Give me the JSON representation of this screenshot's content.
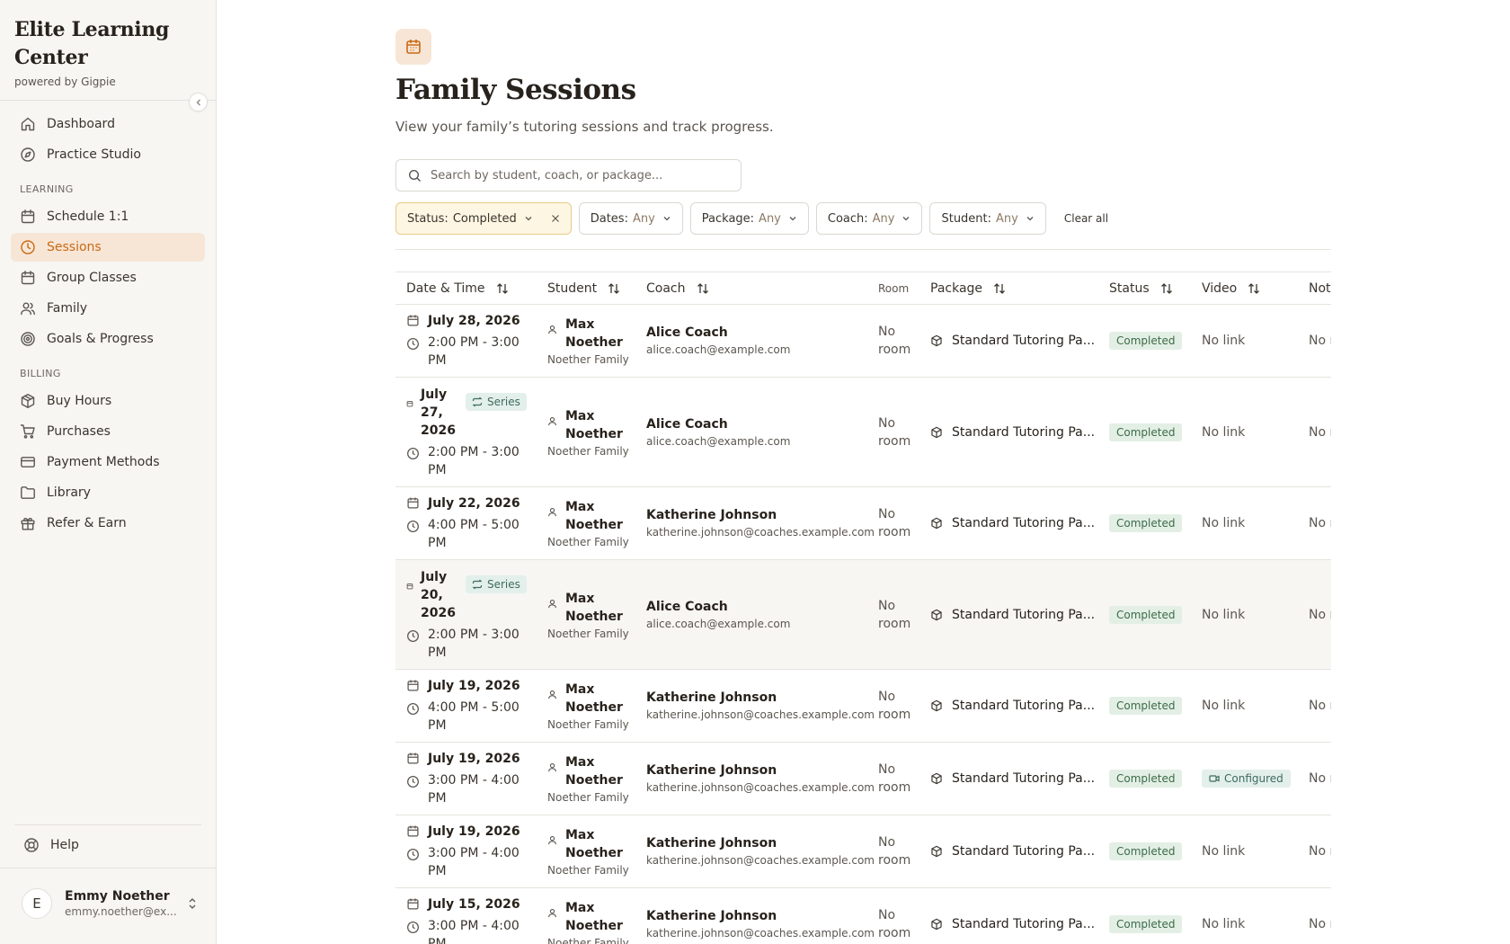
{
  "brand": {
    "title": "Elite Learning Center",
    "subtitle": "powered by Gigpie"
  },
  "nav": {
    "top": [
      {
        "label": "Dashboard",
        "icon": "home-icon"
      },
      {
        "label": "Practice Studio",
        "icon": "compass-icon"
      }
    ],
    "learning_label": "LEARNING",
    "learning": [
      {
        "label": "Schedule 1:1",
        "icon": "calendar-icon"
      },
      {
        "label": "Sessions",
        "icon": "clock-icon",
        "active": true
      },
      {
        "label": "Group Classes",
        "icon": "calendar-icon"
      },
      {
        "label": "Family",
        "icon": "users-icon"
      },
      {
        "label": "Goals & Progress",
        "icon": "target-icon"
      }
    ],
    "billing_label": "BILLING",
    "billing": [
      {
        "label": "Buy Hours",
        "icon": "package-icon"
      },
      {
        "label": "Purchases",
        "icon": "cart-icon"
      },
      {
        "label": "Payment Methods",
        "icon": "card-icon"
      },
      {
        "label": "Library",
        "icon": "folder-icon"
      },
      {
        "label": "Refer & Earn",
        "icon": "gift-icon"
      }
    ],
    "help": "Help"
  },
  "user": {
    "initial": "E",
    "name": "Emmy Noether",
    "email": "emmy.noether@ex..."
  },
  "page": {
    "title": "Family Sessions",
    "subtitle": "View your family’s tutoring sessions and track progress."
  },
  "search": {
    "placeholder": "Search by student, coach, or package..."
  },
  "filters": [
    {
      "key": "Status:",
      "value": "Completed",
      "active": true
    },
    {
      "key": "Dates:",
      "value": "Any"
    },
    {
      "key": "Package:",
      "value": "Any"
    },
    {
      "key": "Coach:",
      "value": "Any"
    },
    {
      "key": "Student:",
      "value": "Any"
    }
  ],
  "clear_all": "Clear all",
  "table": {
    "columns": {
      "datetime": "Date & Time",
      "student": "Student",
      "coach": "Coach",
      "room": "Room",
      "package": "Package",
      "status": "Status",
      "video": "Video",
      "notes": "Notes"
    },
    "series_label": "Series",
    "rows": [
      {
        "date": "July 28, 2026",
        "time": "2:00 PM - 3:00 PM",
        "series": false,
        "student": "Max Noether",
        "family": "Noether Family",
        "coach": "Alice Coach",
        "coach_email": "alice.coach@example.com",
        "room": "No room",
        "package": "Standard Tutoring Pa...",
        "status": "Completed",
        "video": "No link",
        "notes": "No n"
      },
      {
        "date": "July 27, 2026",
        "time": "2:00 PM - 3:00 PM",
        "series": true,
        "student": "Max Noether",
        "family": "Noether Family",
        "coach": "Alice Coach",
        "coach_email": "alice.coach@example.com",
        "room": "No room",
        "package": "Standard Tutoring Pa...",
        "status": "Completed",
        "video": "No link",
        "notes": "No n"
      },
      {
        "date": "July 22, 2026",
        "time": "4:00 PM - 5:00 PM",
        "series": false,
        "student": "Max Noether",
        "family": "Noether Family",
        "coach": "Katherine Johnson",
        "coach_email": "katherine.johnson@coaches.example.com",
        "room": "No room",
        "package": "Standard Tutoring Pa...",
        "status": "Completed",
        "video": "No link",
        "notes": "No n"
      },
      {
        "date": "July 20, 2026",
        "time": "2:00 PM - 3:00 PM",
        "series": true,
        "highlight": true,
        "student": "Max Noether",
        "family": "Noether Family",
        "coach": "Alice Coach",
        "coach_email": "alice.coach@example.com",
        "room": "No room",
        "package": "Standard Tutoring Pa...",
        "status": "Completed",
        "video": "No link",
        "notes": "No n"
      },
      {
        "date": "July 19, 2026",
        "time": "4:00 PM - 5:00 PM",
        "series": false,
        "student": "Max Noether",
        "family": "Noether Family",
        "coach": "Katherine Johnson",
        "coach_email": "katherine.johnson@coaches.example.com",
        "room": "No room",
        "package": "Standard Tutoring Pa...",
        "status": "Completed",
        "video": "No link",
        "notes": "No n"
      },
      {
        "date": "July 19, 2026",
        "time": "3:00 PM - 4:00 PM",
        "series": false,
        "student": "Max Noether",
        "family": "Noether Family",
        "coach": "Katherine Johnson",
        "coach_email": "katherine.johnson@coaches.example.com",
        "room": "No room",
        "package": "Standard Tutoring Pa...",
        "status": "Completed",
        "video": "Configured",
        "video_configured": true,
        "notes": "No n"
      },
      {
        "date": "July 19, 2026",
        "time": "3:00 PM - 4:00 PM",
        "series": false,
        "student": "Max Noether",
        "family": "Noether Family",
        "coach": "Katherine Johnson",
        "coach_email": "katherine.johnson@coaches.example.com",
        "room": "No room",
        "package": "Standard Tutoring Pa...",
        "status": "Completed",
        "video": "No link",
        "notes": "No n"
      },
      {
        "date": "July 15, 2026",
        "time": "3:00 PM - 4:00 PM",
        "series": false,
        "student": "Max Noether",
        "family": "Noether Family",
        "coach": "Katherine Johnson",
        "coach_email": "katherine.johnson@coaches.example.com",
        "room": "No room",
        "package": "Standard Tutoring Pa...",
        "status": "Completed",
        "video": "No link",
        "notes": "No n"
      }
    ]
  },
  "colors": {
    "accent": "#c96a16",
    "active_bg": "#f7e6d6",
    "status_bg": "#e3efe5",
    "status_fg": "#3b6b48"
  }
}
